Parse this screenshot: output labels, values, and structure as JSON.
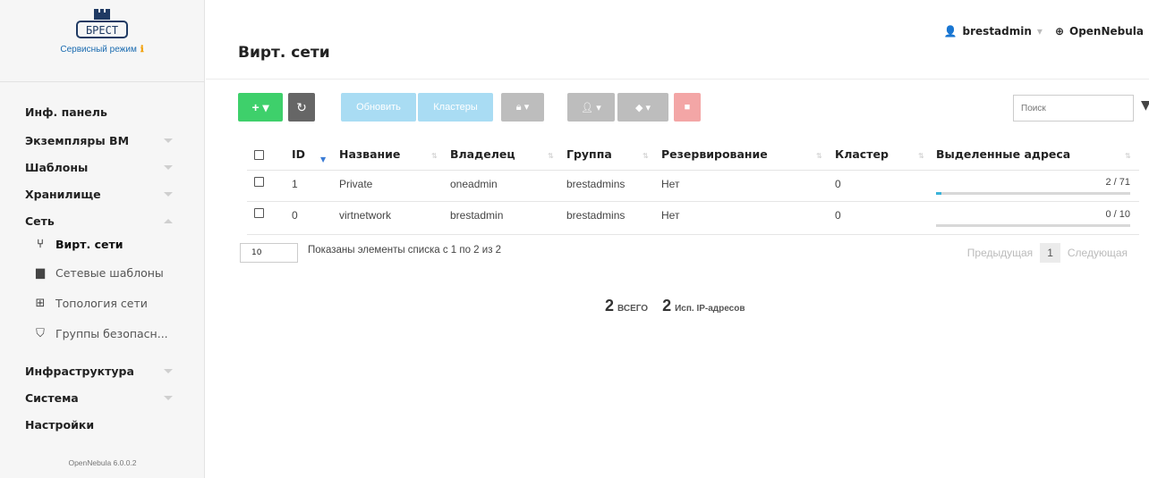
{
  "logo": {
    "text": "БРЕСТ"
  },
  "sidebar": {
    "mode": "Сервисный режим",
    "items": [
      {
        "label": "Инф. панель",
        "has_chevron": false
      },
      {
        "label": "Экземпляры ВМ",
        "has_chevron": true
      },
      {
        "label": "Шаблоны",
        "has_chevron": true
      },
      {
        "label": "Хранилище",
        "has_chevron": true
      },
      {
        "label": "Сеть",
        "has_chevron": true,
        "expanded": true
      },
      {
        "label": "Инфраструктура",
        "has_chevron": true
      },
      {
        "label": "Система",
        "has_chevron": true
      },
      {
        "label": "Настройки",
        "has_chevron": false
      }
    ],
    "subitems": [
      {
        "label": "Вирт. сети",
        "icon": "network-fork-icon",
        "active": true
      },
      {
        "label": "Сетевые шаблоны",
        "icon": "templates-stack-icon",
        "active": false
      },
      {
        "label": "Топология сети",
        "icon": "topology-icon",
        "active": false
      },
      {
        "label": "Группы безопасн...",
        "icon": "shield-icon",
        "active": false
      }
    ],
    "version": "OpenNebula 6.0.0.2"
  },
  "header": {
    "title": "Вирт. сети",
    "user": "brestadmin",
    "zone": "OpenNebula"
  },
  "toolbar": {
    "add_label": "+ ▾",
    "refresh_label": "↻",
    "update_label": "Обновить",
    "clusters_label": "Кластеры",
    "search_placeholder": "Поиск"
  },
  "table": {
    "columns": [
      "ID",
      "Название",
      "Владелец",
      "Группа",
      "Резервирование",
      "Кластер",
      "Выделенные адреса"
    ],
    "rows": [
      {
        "id": "1",
        "name": "Private",
        "owner": "oneadmin",
        "group": "brestadmins",
        "reservation": "Нет",
        "cluster": "0",
        "leases": "2 / 71",
        "leases_fraction": 0.028
      },
      {
        "id": "0",
        "name": "virtnetwork",
        "owner": "brestadmin",
        "group": "brestadmins",
        "reservation": "Нет",
        "cluster": "0",
        "leases": "0 / 10",
        "leases_fraction": 0.0
      }
    ]
  },
  "footer": {
    "page_size": "10",
    "shown": "Показаны элементы списка с 1 по 2 из 2",
    "prev": "Предыдущая",
    "page": "1",
    "next": "Следующая"
  },
  "totals": {
    "total_num": "2",
    "total_label": "ВСЕГО",
    "ip_num": "2",
    "ip_label": "Исп. IP-адресов"
  }
}
